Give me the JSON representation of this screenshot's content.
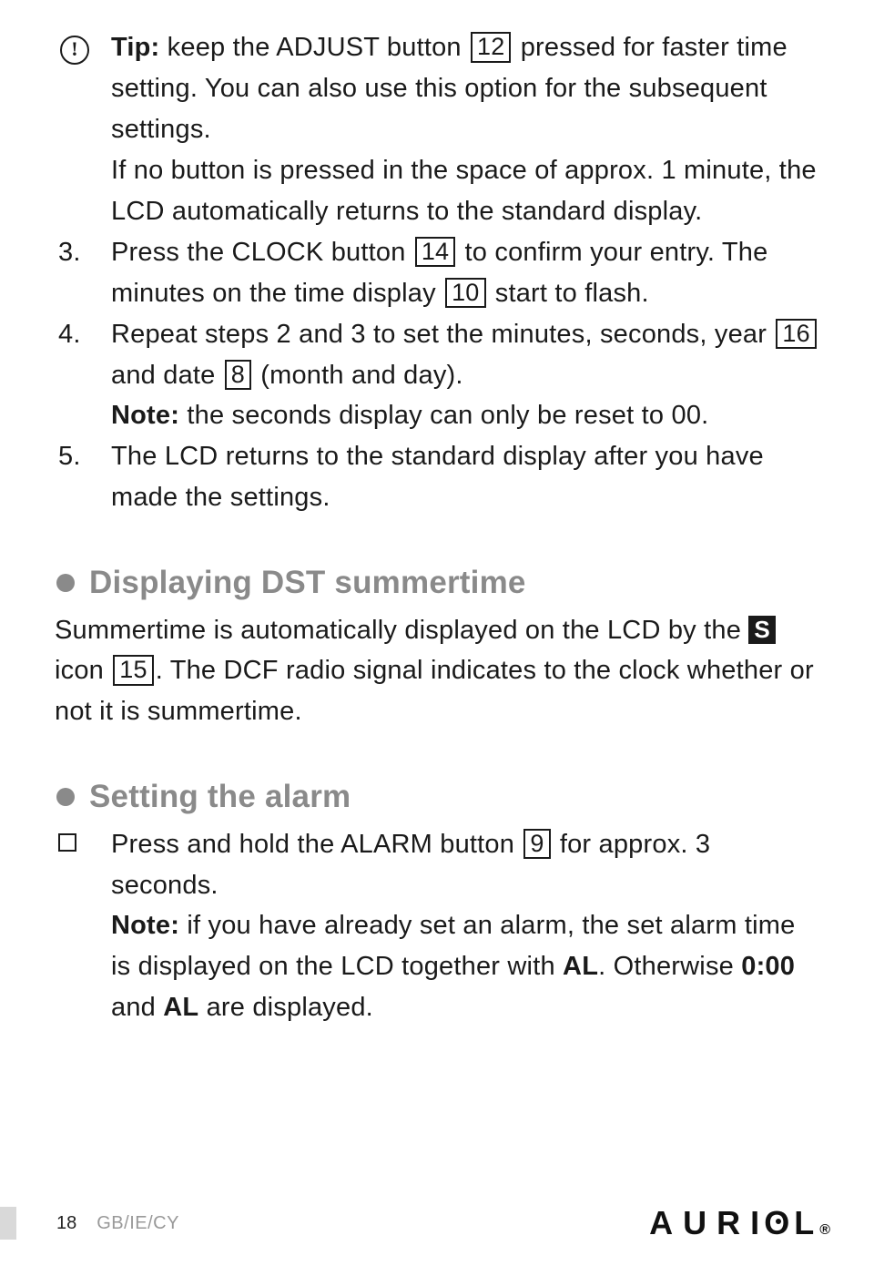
{
  "tip": {
    "label": "Tip:",
    "line1a": " keep the ADJUST button ",
    "ref1": "12",
    "line1b": " pressed for faster time setting. You can also use this option for the subsequent settings.",
    "line2": "If no button is pressed in the space of approx. 1 minute, the LCD automatically returns to the standard display."
  },
  "steps": {
    "s3": {
      "num": "3.",
      "a": "Press the CLOCK button ",
      "ref1": "14",
      "b": " to confirm your entry. The minutes on the time display ",
      "ref2": "10",
      "c": " start to flash."
    },
    "s4": {
      "num": "4.",
      "a": "Repeat steps 2 and 3 to set the minutes, seconds, year ",
      "ref1": "16",
      "b": " and date ",
      "ref2": "8",
      "c": " (month and day).",
      "noteLabel": "Note:",
      "note": " the seconds display can only be reset to 00."
    },
    "s5": {
      "num": "5.",
      "text": "The LCD returns to the standard display after you have made the settings."
    }
  },
  "dst": {
    "heading": "Displaying DST summertime",
    "a": "Summertime is automatically displayed on the LCD by the ",
    "sIcon": "S",
    "b": " icon ",
    "ref": "15",
    "c": ". The DCF radio signal indicates to the clock whether or not it is summertime."
  },
  "alarm": {
    "heading": "Setting the alarm",
    "a": "Press and hold the ALARM button ",
    "ref": "9",
    "b": " for approx. 3 seconds.",
    "noteLabel": "Note:",
    "noteA": " if you have already set an alarm, the set alarm time is displayed on the LCD together with ",
    "al1": "AL",
    "noteB": ". Otherwise ",
    "time0": "0:00",
    "noteC": " and ",
    "al2": "AL",
    "noteD": " are displayed."
  },
  "footer": {
    "page": "18",
    "locale": "GB/IE/CY",
    "brand": "AURIOL",
    "reg": "®"
  }
}
